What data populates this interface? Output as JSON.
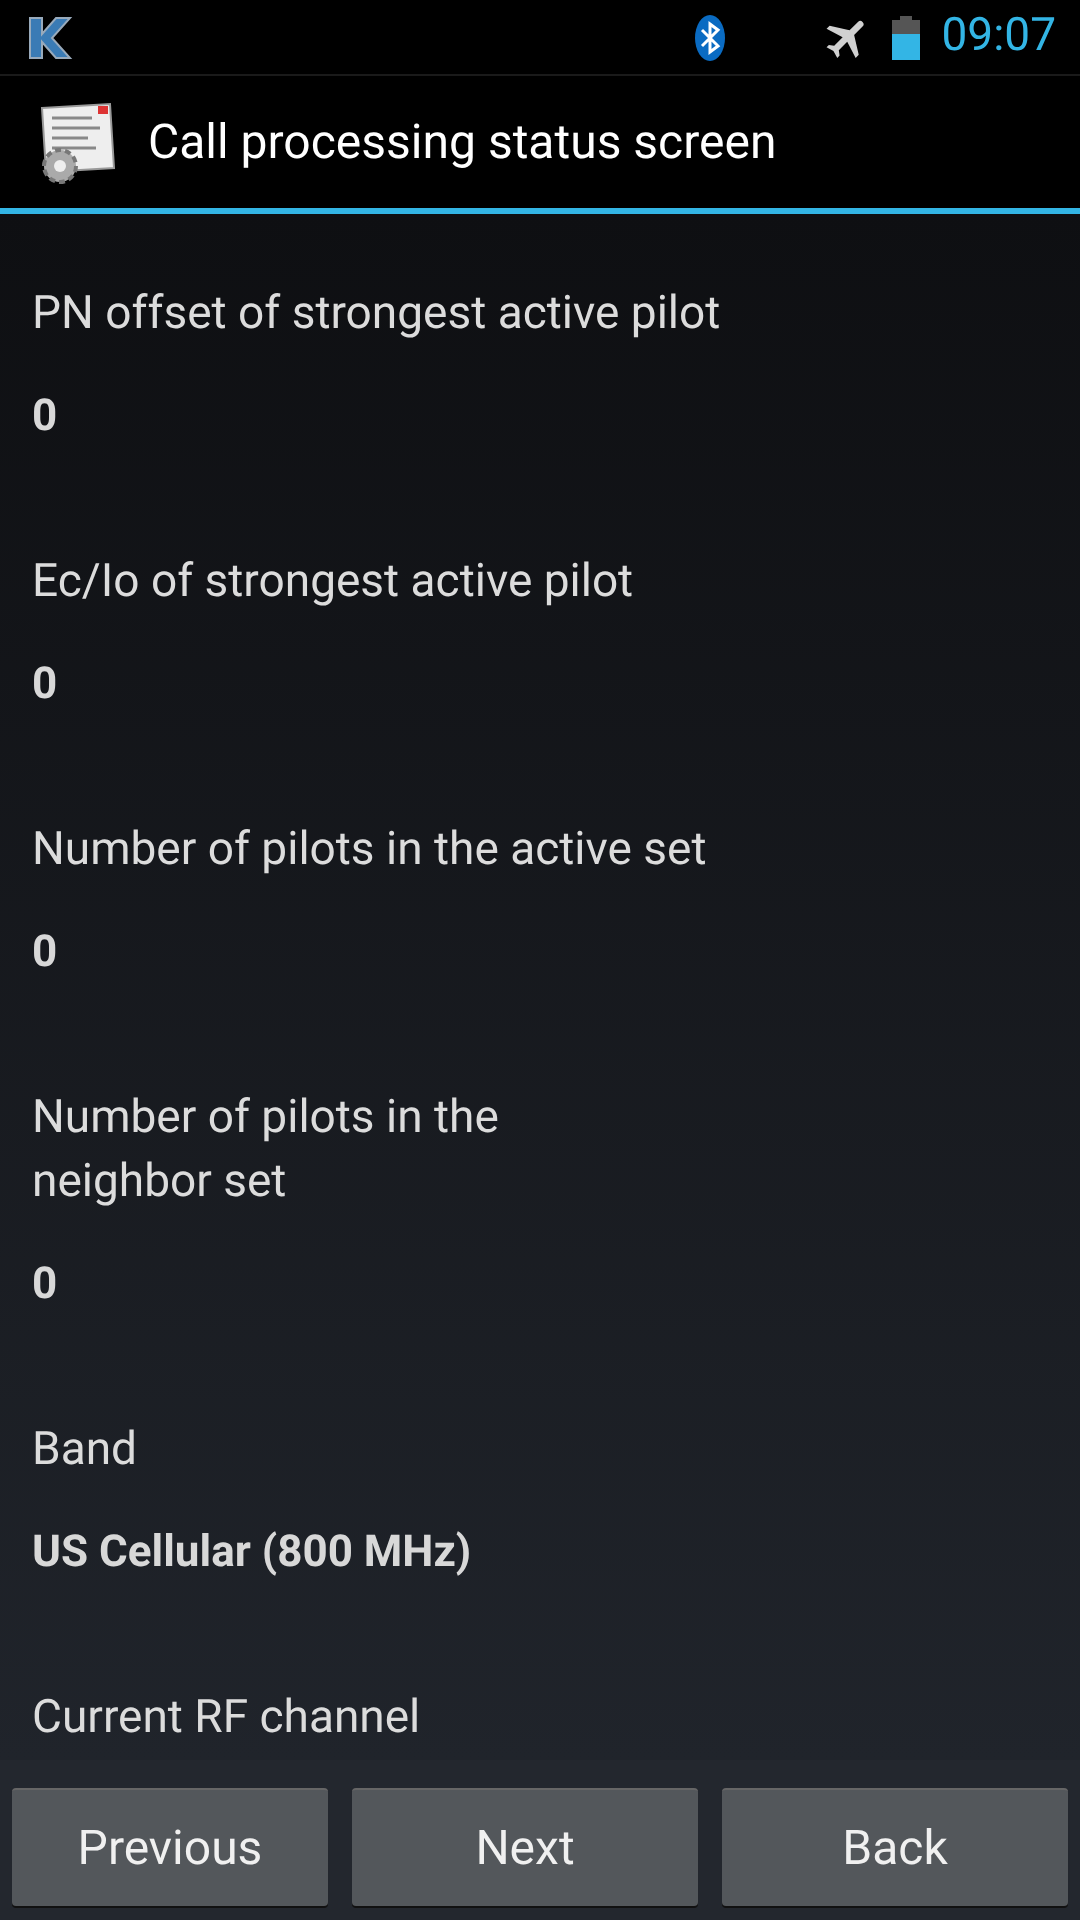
{
  "status_bar": {
    "time": "09:07"
  },
  "window": {
    "title": "Call processing status screen"
  },
  "fields": [
    {
      "label": "PN offset of strongest active pilot",
      "value": "0"
    },
    {
      "label": "Ec/Io of strongest active pilot",
      "value": "0"
    },
    {
      "label": "Number of pilots in the active set",
      "value": "0"
    },
    {
      "label": "Number of pilots in the\nneighbor set",
      "value": "0"
    },
    {
      "label": "Band",
      "value": "US Cellular (800 MHz)"
    },
    {
      "label": "Current RF channel"
    }
  ],
  "buttons": [
    "Previous",
    "Next",
    "Back"
  ]
}
